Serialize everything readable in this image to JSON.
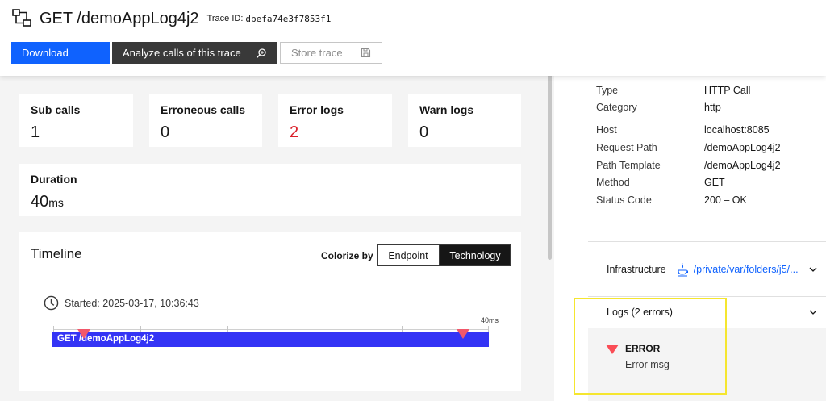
{
  "header": {
    "title": "GET /demoAppLog4j2",
    "trace_id_label": "Trace ID:",
    "trace_id": "dbefa74e3f7853f1",
    "icon": "trace-icon"
  },
  "buttons": {
    "download": "Download",
    "analyze": "Analyze calls of this trace",
    "analyze_icon": "search-icon",
    "store": "Store trace",
    "store_icon": "save-icon"
  },
  "stats": {
    "sub_calls": {
      "label": "Sub calls",
      "value": "1"
    },
    "erroneous_calls": {
      "label": "Erroneous calls",
      "value": "0"
    },
    "error_logs": {
      "label": "Error logs",
      "value": "2"
    },
    "warn_logs": {
      "label": "Warn logs",
      "value": "0"
    },
    "duration": {
      "label": "Duration",
      "value": "40",
      "unit": "ms"
    }
  },
  "timeline": {
    "title": "Timeline",
    "colorize_label": "Colorize by",
    "options": [
      "Endpoint",
      "Technology"
    ],
    "selected": "Technology",
    "started": "Started: 2025-03-17, 10:36:43",
    "axis_end": "40ms",
    "bar_label": "GET /demoAppLog4j2",
    "bar_color": "#3434f5",
    "error_markers_ms": [
      2.9,
      37.6
    ]
  },
  "details": {
    "props": [
      {
        "key": "Type",
        "value": "HTTP Call"
      },
      {
        "key": "Category",
        "value": "http"
      },
      {
        "key": "Host",
        "value": "localhost:8085"
      },
      {
        "key": "Request Path",
        "value": "/demoAppLog4j2"
      },
      {
        "key": "Path Template",
        "value": "/demoAppLog4j2"
      },
      {
        "key": "Method",
        "value": "GET"
      },
      {
        "key": "Status Code",
        "value": "200 – OK"
      }
    ],
    "infrastructure": {
      "label": "Infrastructure",
      "link": "/private/var/folders/j5/...",
      "icon": "java-icon"
    },
    "logs": {
      "label": "Logs (2 errors)",
      "entry": {
        "level": "ERROR",
        "message": "Error msg"
      }
    }
  },
  "colors": {
    "primary": "#0f62fe",
    "error": "#da1e28",
    "highlight": "#f5e62f"
  }
}
